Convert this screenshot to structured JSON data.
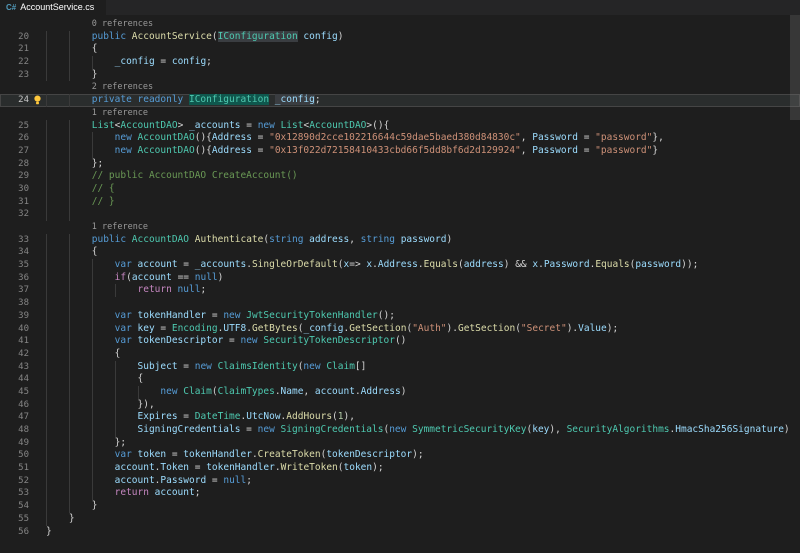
{
  "tab": {
    "title": "AccountService.cs",
    "icon_text": "C#"
  },
  "palette": {
    "editor_background": "#1e1e1e",
    "tabbar_background": "#252526",
    "line_number": "#858585",
    "active_line_number": "#c6c6c6",
    "indent_guide": "#3a3a3a",
    "codelens_text": "#999999",
    "lightbulb": "#ffc83d",
    "csharp_icon": "#519aba",
    "tokens": {
      "kw": "#569cd6",
      "ctrl": "#c586c0",
      "ty": "#4ec9b0",
      "fn": "#dcdcaa",
      "va": "#9cdcfe",
      "st": "#ce9178",
      "nu": "#b5cea8",
      "cm": "#6a9955",
      "pu": "#d4d4d4"
    },
    "highlights": {
      "occ": "#3a3d41",
      "sel": "#0f574d"
    }
  },
  "editor": {
    "rows": [
      {
        "k": "lens",
        "i": 8,
        "t": "0 references"
      },
      {
        "k": "c",
        "n": 20,
        "i": 8,
        "tok": [
          [
            "kw",
            "public "
          ],
          [
            "fn",
            "AccountService"
          ],
          [
            "pu",
            "("
          ],
          [
            "ty",
            "IConfiguration",
            "occ"
          ],
          [
            "va",
            " config"
          ],
          [
            "pu",
            ")"
          ]
        ]
      },
      {
        "k": "c",
        "n": 21,
        "i": 8,
        "tok": [
          [
            "pu",
            "{"
          ]
        ]
      },
      {
        "k": "c",
        "n": 22,
        "i": 12,
        "tok": [
          [
            "va",
            "_config"
          ],
          [
            "pu",
            " = "
          ],
          [
            "va",
            "config"
          ],
          [
            "pu",
            ";"
          ]
        ]
      },
      {
        "k": "c",
        "n": 23,
        "i": 8,
        "tok": [
          [
            "pu",
            "}"
          ]
        ]
      },
      {
        "k": "lens",
        "i": 8,
        "t": "2 references"
      },
      {
        "k": "c",
        "n": 24,
        "i": 8,
        "hl": true,
        "bulb": true,
        "tok": [
          [
            "kw",
            "private readonly "
          ],
          [
            "ty",
            "IConfiguration",
            "sel"
          ],
          [
            "pu",
            " "
          ],
          [
            "va",
            "_config",
            "occ"
          ],
          [
            "pu",
            ";"
          ]
        ]
      },
      {
        "k": "lens",
        "i": 8,
        "t": "1 reference"
      },
      {
        "k": "c",
        "n": 25,
        "i": 8,
        "tok": [
          [
            "ty",
            "List"
          ],
          [
            "pu",
            "<"
          ],
          [
            "ty",
            "AccountDAO"
          ],
          [
            "pu",
            "> "
          ],
          [
            "va",
            "_accounts"
          ],
          [
            "pu",
            " = "
          ],
          [
            "kw",
            "new "
          ],
          [
            "ty",
            "List"
          ],
          [
            "pu",
            "<"
          ],
          [
            "ty",
            "AccountDAO"
          ],
          [
            "pu",
            ">(){"
          ]
        ]
      },
      {
        "k": "c",
        "n": 26,
        "i": 12,
        "tok": [
          [
            "kw",
            "new "
          ],
          [
            "ty",
            "AccountDAO"
          ],
          [
            "pu",
            "(){"
          ],
          [
            "va",
            "Address"
          ],
          [
            "pu",
            " = "
          ],
          [
            "st",
            "\"0x12890d2cce102216644c59dae5baed380d84830c\""
          ],
          [
            "pu",
            ", "
          ],
          [
            "va",
            "Password"
          ],
          [
            "pu",
            " = "
          ],
          [
            "st",
            "\"password\""
          ],
          [
            "pu",
            "},"
          ]
        ]
      },
      {
        "k": "c",
        "n": 27,
        "i": 12,
        "tok": [
          [
            "kw",
            "new "
          ],
          [
            "ty",
            "AccountDAO"
          ],
          [
            "pu",
            "(){"
          ],
          [
            "va",
            "Address"
          ],
          [
            "pu",
            " = "
          ],
          [
            "st",
            "\"0x13f022d72158410433cbd66f5dd8bf6d2d129924\""
          ],
          [
            "pu",
            ", "
          ],
          [
            "va",
            "Password"
          ],
          [
            "pu",
            " = "
          ],
          [
            "st",
            "\"password\""
          ],
          [
            "pu",
            "}"
          ]
        ]
      },
      {
        "k": "c",
        "n": 28,
        "i": 8,
        "tok": [
          [
            "pu",
            "};"
          ]
        ]
      },
      {
        "k": "c",
        "n": 29,
        "i": 8,
        "tok": [
          [
            "cm",
            "// public AccountDAO CreateAccount()"
          ]
        ]
      },
      {
        "k": "c",
        "n": 30,
        "i": 8,
        "tok": [
          [
            "cm",
            "// {"
          ]
        ]
      },
      {
        "k": "c",
        "n": 31,
        "i": 8,
        "tok": [
          [
            "cm",
            "// }"
          ]
        ]
      },
      {
        "k": "c",
        "n": 32,
        "i": 8,
        "tok": []
      },
      {
        "k": "lens",
        "i": 8,
        "t": "1 reference"
      },
      {
        "k": "c",
        "n": 33,
        "i": 8,
        "tok": [
          [
            "kw",
            "public "
          ],
          [
            "ty",
            "AccountDAO"
          ],
          [
            "pu",
            " "
          ],
          [
            "fn",
            "Authenticate"
          ],
          [
            "pu",
            "("
          ],
          [
            "kw",
            "string"
          ],
          [
            "va",
            " address"
          ],
          [
            "pu",
            ", "
          ],
          [
            "kw",
            "string"
          ],
          [
            "va",
            " password"
          ],
          [
            "pu",
            ")"
          ]
        ]
      },
      {
        "k": "c",
        "n": 34,
        "i": 8,
        "tok": [
          [
            "pu",
            "{"
          ]
        ]
      },
      {
        "k": "c",
        "n": 35,
        "i": 12,
        "tok": [
          [
            "kw",
            "var"
          ],
          [
            "va",
            " account"
          ],
          [
            "pu",
            " = "
          ],
          [
            "va",
            "_accounts"
          ],
          [
            "pu",
            "."
          ],
          [
            "fn",
            "SingleOrDefault"
          ],
          [
            "pu",
            "("
          ],
          [
            "va",
            "x"
          ],
          [
            "pu",
            "=> "
          ],
          [
            "va",
            "x"
          ],
          [
            "pu",
            "."
          ],
          [
            "va",
            "Address"
          ],
          [
            "pu",
            "."
          ],
          [
            "fn",
            "Equals"
          ],
          [
            "pu",
            "("
          ],
          [
            "va",
            "address"
          ],
          [
            "pu",
            ") && "
          ],
          [
            "va",
            "x"
          ],
          [
            "pu",
            "."
          ],
          [
            "va",
            "Password"
          ],
          [
            "pu",
            "."
          ],
          [
            "fn",
            "Equals"
          ],
          [
            "pu",
            "("
          ],
          [
            "va",
            "password"
          ],
          [
            "pu",
            "));"
          ]
        ]
      },
      {
        "k": "c",
        "n": 36,
        "i": 12,
        "tok": [
          [
            "ctrl",
            "if"
          ],
          [
            "pu",
            "("
          ],
          [
            "va",
            "account"
          ],
          [
            "pu",
            " == "
          ],
          [
            "kw",
            "null"
          ],
          [
            "pu",
            ")"
          ]
        ]
      },
      {
        "k": "c",
        "n": 37,
        "i": 16,
        "tok": [
          [
            "ctrl",
            "return "
          ],
          [
            "kw",
            "null"
          ],
          [
            "pu",
            ";"
          ]
        ]
      },
      {
        "k": "c",
        "n": 38,
        "i": 12,
        "tok": []
      },
      {
        "k": "c",
        "n": 39,
        "i": 12,
        "tok": [
          [
            "kw",
            "var"
          ],
          [
            "va",
            " tokenHandler"
          ],
          [
            "pu",
            " = "
          ],
          [
            "kw",
            "new "
          ],
          [
            "ty",
            "JwtSecurityTokenHandler"
          ],
          [
            "pu",
            "();"
          ]
        ]
      },
      {
        "k": "c",
        "n": 40,
        "i": 12,
        "tok": [
          [
            "kw",
            "var"
          ],
          [
            "va",
            " key"
          ],
          [
            "pu",
            " = "
          ],
          [
            "ty",
            "Encoding"
          ],
          [
            "pu",
            "."
          ],
          [
            "va",
            "UTF8"
          ],
          [
            "pu",
            "."
          ],
          [
            "fn",
            "GetBytes"
          ],
          [
            "pu",
            "("
          ],
          [
            "va",
            "_config"
          ],
          [
            "pu",
            "."
          ],
          [
            "fn",
            "GetSection"
          ],
          [
            "pu",
            "("
          ],
          [
            "st",
            "\"Auth\""
          ],
          [
            "pu",
            ")."
          ],
          [
            "fn",
            "GetSection"
          ],
          [
            "pu",
            "("
          ],
          [
            "st",
            "\"Secret\""
          ],
          [
            "pu",
            ")."
          ],
          [
            "va",
            "Value"
          ],
          [
            "pu",
            ");"
          ]
        ]
      },
      {
        "k": "c",
        "n": 41,
        "i": 12,
        "tok": [
          [
            "kw",
            "var"
          ],
          [
            "va",
            " tokenDescriptor"
          ],
          [
            "pu",
            " = "
          ],
          [
            "kw",
            "new "
          ],
          [
            "ty",
            "SecurityTokenDescriptor"
          ],
          [
            "pu",
            "()"
          ]
        ]
      },
      {
        "k": "c",
        "n": 42,
        "i": 12,
        "tok": [
          [
            "pu",
            "{"
          ]
        ]
      },
      {
        "k": "c",
        "n": 43,
        "i": 16,
        "tok": [
          [
            "va",
            "Subject"
          ],
          [
            "pu",
            " = "
          ],
          [
            "kw",
            "new "
          ],
          [
            "ty",
            "ClaimsIdentity"
          ],
          [
            "pu",
            "("
          ],
          [
            "kw",
            "new "
          ],
          [
            "ty",
            "Claim"
          ],
          [
            "pu",
            "[]"
          ]
        ]
      },
      {
        "k": "c",
        "n": 44,
        "i": 16,
        "tok": [
          [
            "pu",
            "{"
          ]
        ]
      },
      {
        "k": "c",
        "n": 45,
        "i": 20,
        "tok": [
          [
            "kw",
            "new "
          ],
          [
            "ty",
            "Claim"
          ],
          [
            "pu",
            "("
          ],
          [
            "ty",
            "ClaimTypes"
          ],
          [
            "pu",
            "."
          ],
          [
            "va",
            "Name"
          ],
          [
            "pu",
            ", "
          ],
          [
            "va",
            "account"
          ],
          [
            "pu",
            "."
          ],
          [
            "va",
            "Address"
          ],
          [
            "pu",
            ")"
          ]
        ]
      },
      {
        "k": "c",
        "n": 46,
        "i": 16,
        "tok": [
          [
            "pu",
            "}),"
          ]
        ]
      },
      {
        "k": "c",
        "n": 47,
        "i": 16,
        "tok": [
          [
            "va",
            "Expires"
          ],
          [
            "pu",
            " = "
          ],
          [
            "ty",
            "DateTime"
          ],
          [
            "pu",
            "."
          ],
          [
            "va",
            "UtcNow"
          ],
          [
            "pu",
            "."
          ],
          [
            "fn",
            "AddHours"
          ],
          [
            "pu",
            "("
          ],
          [
            "nu",
            "1"
          ],
          [
            "pu",
            "),"
          ]
        ]
      },
      {
        "k": "c",
        "n": 48,
        "i": 16,
        "tok": [
          [
            "va",
            "SigningCredentials"
          ],
          [
            "pu",
            " = "
          ],
          [
            "kw",
            "new "
          ],
          [
            "ty",
            "SigningCredentials"
          ],
          [
            "pu",
            "("
          ],
          [
            "kw",
            "new "
          ],
          [
            "ty",
            "SymmetricSecurityKey"
          ],
          [
            "pu",
            "("
          ],
          [
            "va",
            "key"
          ],
          [
            "pu",
            "), "
          ],
          [
            "ty",
            "SecurityAlgorithms"
          ],
          [
            "pu",
            "."
          ],
          [
            "va",
            "HmacSha256Signature"
          ],
          [
            "pu",
            ")"
          ]
        ]
      },
      {
        "k": "c",
        "n": 49,
        "i": 12,
        "tok": [
          [
            "pu",
            "};"
          ]
        ]
      },
      {
        "k": "c",
        "n": 50,
        "i": 12,
        "tok": [
          [
            "kw",
            "var"
          ],
          [
            "va",
            " token"
          ],
          [
            "pu",
            " = "
          ],
          [
            "va",
            "tokenHandler"
          ],
          [
            "pu",
            "."
          ],
          [
            "fn",
            "CreateToken"
          ],
          [
            "pu",
            "("
          ],
          [
            "va",
            "tokenDescriptor"
          ],
          [
            "pu",
            ");"
          ]
        ]
      },
      {
        "k": "c",
        "n": 51,
        "i": 12,
        "tok": [
          [
            "va",
            "account"
          ],
          [
            "pu",
            "."
          ],
          [
            "va",
            "Token"
          ],
          [
            "pu",
            " = "
          ],
          [
            "va",
            "tokenHandler"
          ],
          [
            "pu",
            "."
          ],
          [
            "fn",
            "WriteToken"
          ],
          [
            "pu",
            "("
          ],
          [
            "va",
            "token"
          ],
          [
            "pu",
            ");"
          ]
        ]
      },
      {
        "k": "c",
        "n": 52,
        "i": 12,
        "tok": [
          [
            "va",
            "account"
          ],
          [
            "pu",
            "."
          ],
          [
            "va",
            "Password"
          ],
          [
            "pu",
            " = "
          ],
          [
            "kw",
            "null"
          ],
          [
            "pu",
            ";"
          ]
        ]
      },
      {
        "k": "c",
        "n": 53,
        "i": 12,
        "tok": [
          [
            "ctrl",
            "return"
          ],
          [
            "va",
            " account"
          ],
          [
            "pu",
            ";"
          ]
        ]
      },
      {
        "k": "c",
        "n": 54,
        "i": 8,
        "tok": [
          [
            "pu",
            "}"
          ]
        ]
      },
      {
        "k": "c",
        "n": 55,
        "i": 4,
        "tok": [
          [
            "pu",
            "}"
          ]
        ]
      },
      {
        "k": "c",
        "n": 56,
        "i": 0,
        "tok": [
          [
            "pu",
            "}"
          ]
        ]
      }
    ]
  }
}
